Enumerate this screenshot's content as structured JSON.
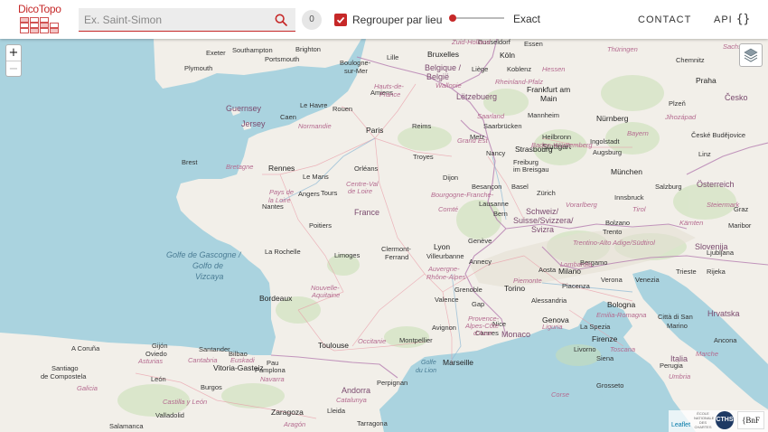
{
  "header": {
    "logo_text": "DicoTopo",
    "search": {
      "placeholder": "Ex. Saint-Simon",
      "value": ""
    },
    "result_count": "0",
    "group_checkbox": {
      "label": "Regrouper par lieu",
      "checked": true
    },
    "match_slider": {
      "label": "Exact",
      "value_fraction": 0
    },
    "contact_label": "CONTACT",
    "api_label": "API",
    "api_icon": "{}"
  },
  "map": {
    "zoom_in_label": "+",
    "zoom_out_label": "−",
    "layers_icon": "layers-icon",
    "attribution": {
      "leaflet_label": "Leaflet",
      "ehess_label": "ÉCOLE NATIONALE DES CHARTES",
      "cths_label": "CTHS",
      "bnf_label": "{BnF"
    },
    "places": {
      "dusseldorf": "Dusseldorf",
      "essen": "Essen",
      "koln": "Köln",
      "koblenz": "Koblenz",
      "belgique": "Belgique /",
      "belgie": "België",
      "liege": "Liège",
      "lille": "Lille",
      "bruxelles": "Bruxelles",
      "chemnitz": "Chemnitz",
      "praha": "Praha",
      "cesko": "Česko",
      "plzen": "Plzeň",
      "nurnberg": "Nürnberg",
      "frankfurt": "Frankfurt am",
      "main": "Main",
      "mannheim": "Mannheim",
      "letzebuerg": "Lëtzebuerg",
      "saarbrucken": "Saarbrücken",
      "heilbronn": "Heilbronn",
      "stuttgart": "Stuttgart",
      "ingolstadt": "Ingolstadt",
      "augsburg": "Augsburg",
      "munchen": "München",
      "budejovice": "České Budějovice",
      "linz": "Linz",
      "salzburg": "Salzburg",
      "osterreich": "Österreich",
      "graz": "Graz",
      "maribor": "Maribor",
      "slovenija": "Slovenija",
      "ljubljana": "Ljubljana",
      "trieste": "Trieste",
      "rijeka": "Rijeka",
      "hrvatska": "Hrvatska",
      "innsbruck": "Innsbruck",
      "freiburg": "Freiburg",
      "imbreisgau": "im Breisgau",
      "basel": "Basel",
      "zurich": "Zürich",
      "schweiz": "Schweiz/",
      "suisse": "Suisse/Svizzera/",
      "svizra": "Svizra",
      "bern": "Bern",
      "lausanne": "Lausanne",
      "geneve": "Genève",
      "annecy": "Annecy",
      "aosta": "Aosta",
      "milano": "Milano",
      "bergamo": "Bergamo",
      "verona": "Verona",
      "venezia": "Venezia",
      "trento": "Trento",
      "bolzano": "Bolzano",
      "torino": "Torino",
      "piacenza": "Piacenza",
      "alessandria": "Alessandria",
      "bologna": "Bologna",
      "genova": "Genova",
      "laspezia": "La Spezia",
      "firenze": "Firenze",
      "cittadisan": "Città di San",
      "marino": "Marino",
      "italia": "Italia",
      "siena": "Siena",
      "perugia": "Perugia",
      "ancona": "Ancona",
      "grosseto": "Grosseto",
      "livorno": "Livorno",
      "monaco": "Monaco",
      "nice": "Nice",
      "cannes": "Cannes",
      "paris": "Paris",
      "reims": "Reims",
      "troyes": "Troyes",
      "nancy": "Nancy",
      "metz": "Metz",
      "strasbourg": "Strasbourg",
      "rouen": "Rouen",
      "amiens": "Amiens",
      "lehavre": "Le Havre",
      "caen": "Caen",
      "rennes": "Rennes",
      "brest": "Brest",
      "lemans": "Le Mans",
      "angers": "Angers",
      "nantes": "Nantes",
      "poitiers": "Poitiers",
      "limoges": "Limoges",
      "larochelle": "La Rochelle",
      "bordeaux": "Bordeaux",
      "toulouse": "Toulouse",
      "montpellier": "Montpellier",
      "marseille": "Marseille",
      "avignon": "Avignon",
      "gap": "Gap",
      "grenoble": "Grenoble",
      "valence": "Valence",
      "villeurbanne": "Villeurbanne",
      "lyon": "Lyon",
      "clermont": "Clermont-",
      "ferrand": "Ferrand",
      "dijon": "Dijon",
      "besancon": "Besançon",
      "orleans": "Orléans",
      "tours": "Tours",
      "france": "France",
      "pau": "Pau",
      "perpignan": "Perpignan",
      "andorra": "Andorra",
      "plymouth": "Plymouth",
      "southampton": "Southampton",
      "brighton": "Brighton",
      "portsmouth": "Portsmouth",
      "exeter": "Exeter",
      "guernsey": "Guernsey",
      "jersey": "Jersey",
      "boulogne": "Boulogne-",
      "surmer": "sur-Mer",
      "acoruna": "A Coruña",
      "santiago": "Santiago",
      "decompostela": "de Compostela",
      "oviedo": "Oviedo",
      "gijon": "Gijón",
      "santander": "Santander",
      "bilbao": "Bilbao",
      "vitoria": "Vitoria-Gasteiz",
      "pamplona": "Pamplona",
      "leon": "León",
      "burgos": "Burgos",
      "valladolid": "Valladolid",
      "zaragoza": "Zaragoza",
      "salamanca": "Salamanca",
      "lleida": "Lleida",
      "tarragona": "Tarragona",
      "golfe1": "Golfe de Gascogne /",
      "golfe2": "Golfo de",
      "golfe3": "Vizcaya",
      "hautsdefrance1": "Hauts-de-",
      "hautsdefrance2": "France",
      "normandie": "Normandie",
      "bretagne": "Bretagne",
      "paysdelaloire1": "Pays de",
      "paysdelaloire2": "la Loire",
      "centrevdl1": "Centre-Val",
      "centrevdl2": "de Loire",
      "grandest": "Grand Est",
      "bourgogne1": "Bourgogne-Franche-",
      "bourgogne2": "Comté",
      "nouvelleaq1": "Nouvelle-",
      "nouvelleaq2": "Aquitaine",
      "auvergne1": "Auvergne-",
      "auvergne2": "Rhône-Alpes",
      "occitanie": "Occitanie",
      "provence1": "Provence-",
      "provence2": "Alpes-Côte",
      "provence3": "d'Azur",
      "golfedulion1": "Golfe",
      "golfedulion2": "du Lion",
      "badenw": "Baden-Württemberg",
      "bayern": "Bayern",
      "hessen": "Hessen",
      "lombardia": "Lombardia",
      "piemonte": "Piemonte",
      "tirol": "Tirol",
      "steiermark": "Steiermark",
      "kaernten": "Kärnten",
      "trentino": "Trentino-Alto Adige/Südtirol",
      "jihozapad": "Jihozápad",
      "bohemia": "Thüringen",
      "sachsen": "Sachsen",
      "asturias": "Asturias",
      "cantabria": "Cantabria",
      "castilla": "Castilla y León",
      "aragon": "Aragón",
      "catalunya": "Catalunya",
      "navarra": "Navarra",
      "paisvasco": "Euskadi",
      "galicia": "Galicia",
      "toscana": "Toscana",
      "umbria": "Umbria",
      "marche": "Marche",
      "emilia": "Emilia-Romagna",
      "liguria": "Liguria",
      "corse": "Corse",
      "zuidholland": "Zuid-Holland",
      "wallonie": "Wallonie",
      "rheinland": "Rheinland-Pfalz",
      "saarland": "Saarland",
      "vorarlberg": "Vorarlberg"
    }
  }
}
